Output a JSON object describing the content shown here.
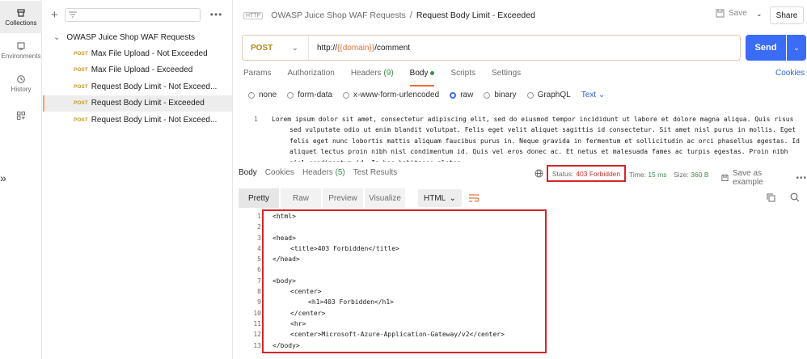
{
  "iconbar": {
    "items": [
      {
        "label": "Collections",
        "icon": "collections-icon"
      },
      {
        "label": "Environments",
        "icon": "environments-icon"
      },
      {
        "label": "History",
        "icon": "history-icon"
      },
      {
        "label": "",
        "icon": "grid-icon"
      }
    ]
  },
  "sidebar": {
    "root": "OWASP Juice Shop WAF Requests",
    "items": [
      {
        "method": "POST",
        "label": "Max File Upload - Not Exceeded"
      },
      {
        "method": "POST",
        "label": "Max File Upload - Exceeded"
      },
      {
        "method": "POST",
        "label": "Request Body Limit - Not Exceed..."
      },
      {
        "method": "POST",
        "label": "Request Body Limit - Exceeded"
      },
      {
        "method": "POST",
        "label": "Request Body Limit - Not Exceed..."
      }
    ]
  },
  "header": {
    "badge": "HTTP",
    "parent": "OWASP Juice Shop WAF Requests",
    "separator": "/",
    "current": "Request Body Limit - Exceeded",
    "save_label": "Save",
    "share_label": "Share"
  },
  "request": {
    "method": "POST",
    "url_prefix": "http://",
    "url_var": "{{domain}}",
    "url_suffix": "/comment",
    "send_label": "Send",
    "tabs": {
      "params": "Params",
      "authorization": "Authorization",
      "headers": "Headers",
      "headers_count": "(9)",
      "body": "Body",
      "scripts": "Scripts",
      "settings": "Settings"
    },
    "cookies_label": "Cookies",
    "body_types": [
      "none",
      "form-data",
      "x-www-form-urlencoded",
      "raw",
      "binary",
      "GraphQL"
    ],
    "raw_format": "Text",
    "body_line_number": "1",
    "body_text": "Lorem ipsum dolor sit amet, consectetur adipiscing elit, sed do eiusmod tempor incididunt ut labore et dolore magna aliqua. Quis risus sed vulputate odio ut enim blandit volutpat. Felis eget velit aliquet sagittis id consectetur. Sit amet nisl purus in mollis. Eget felis eget nunc lobortis mattis aliquam faucibus purus in. Neque gravida in fermentum et sollicitudin ac orci phasellus egestas. Id aliquet lectus proin nibh nisl condimentum id. Quis vel eros donec ac. Et netus et malesuada fames ac turpis egestas. Proin nibh nisl condimentum id. In hac habitasse platea."
  },
  "response": {
    "tabs": {
      "body": "Body",
      "cookies": "Cookies",
      "headers": "Headers",
      "headers_count": "(5)",
      "test_results": "Test Results"
    },
    "status_label": "Status:",
    "status_value": "403 Forbidden",
    "time_label": "Time:",
    "time_value": "15 ms",
    "size_label": "Size:",
    "size_value": "360 B",
    "save_example_label": "Save as example",
    "view_tabs": [
      "Pretty",
      "Raw",
      "Preview",
      "Visualize"
    ],
    "format": "HTML",
    "code_lines": [
      {
        "n": "1",
        "text": "<html>",
        "indent": 0
      },
      {
        "n": "2",
        "text": "",
        "indent": 0
      },
      {
        "n": "3",
        "text": "<head>",
        "indent": 0
      },
      {
        "n": "4",
        "text": "<title>403 Forbidden</title>",
        "indent": 1
      },
      {
        "n": "5",
        "text": "</head>",
        "indent": 0
      },
      {
        "n": "6",
        "text": "",
        "indent": 0
      },
      {
        "n": "7",
        "text": "<body>",
        "indent": 0
      },
      {
        "n": "8",
        "text": "<center>",
        "indent": 1
      },
      {
        "n": "9",
        "text": "<h1>403 Forbidden</h1>",
        "indent": 2
      },
      {
        "n": "10",
        "text": "</center>",
        "indent": 1
      },
      {
        "n": "11",
        "text": "<hr>",
        "indent": 1
      },
      {
        "n": "12",
        "text": "<center>Microsoft-Azure-Application-Gateway/v2</center>",
        "indent": 1
      },
      {
        "n": "13",
        "text": "</body>",
        "indent": 0
      }
    ]
  },
  "colors": {
    "accent_orange": "#f26b3a",
    "send_blue": "#3b6cf6",
    "status_red": "#c4302b",
    "highlight_box": "#d6242a"
  }
}
